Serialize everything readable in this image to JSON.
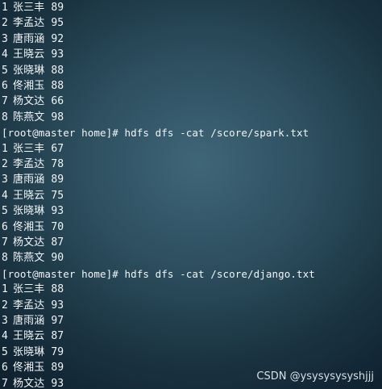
{
  "terminal": {
    "blocks": [
      {
        "command": "",
        "rows": [
          {
            "no": "1",
            "name": "张三丰",
            "score": "89"
          },
          {
            "no": "2",
            "name": "李孟达",
            "score": "95"
          },
          {
            "no": "3",
            "name": "唐雨涵",
            "score": "92"
          },
          {
            "no": "4",
            "name": "王晓云",
            "score": "93"
          },
          {
            "no": "5",
            "name": "张晓琳",
            "score": "88"
          },
          {
            "no": "6",
            "name": "佟湘玉",
            "score": "88"
          },
          {
            "no": "7",
            "name": "杨文达",
            "score": "66"
          },
          {
            "no": "8",
            "name": "陈燕文",
            "score": "98"
          }
        ]
      },
      {
        "command": "[root@master home]# hdfs dfs -cat /score/spark.txt",
        "rows": [
          {
            "no": "1",
            "name": "张三丰",
            "score": "67"
          },
          {
            "no": "2",
            "name": "李孟达",
            "score": "78"
          },
          {
            "no": "3",
            "name": "唐雨涵",
            "score": "89"
          },
          {
            "no": "4",
            "name": "王晓云",
            "score": "75"
          },
          {
            "no": "5",
            "name": "张晓琳",
            "score": "93"
          },
          {
            "no": "6",
            "name": "佟湘玉",
            "score": "70"
          },
          {
            "no": "7",
            "name": "杨文达",
            "score": "87"
          },
          {
            "no": "8",
            "name": "陈燕文",
            "score": "90"
          }
        ]
      },
      {
        "command": "[root@master home]# hdfs dfs -cat /score/django.txt",
        "rows": [
          {
            "no": "1",
            "name": "张三丰",
            "score": "88"
          },
          {
            "no": "2",
            "name": "李孟达",
            "score": "93"
          },
          {
            "no": "3",
            "name": "唐雨涵",
            "score": "97"
          },
          {
            "no": "4",
            "name": "王晓云",
            "score": "87"
          },
          {
            "no": "5",
            "name": "张晓琳",
            "score": "79"
          },
          {
            "no": "6",
            "name": "佟湘玉",
            "score": "89"
          },
          {
            "no": "7",
            "name": "杨文达",
            "score": "93"
          }
        ]
      }
    ]
  },
  "watermark": "CSDN @ysysysysyshjjj",
  "colors": {
    "text": "#f2f5f7",
    "background": "#2d4f60"
  }
}
